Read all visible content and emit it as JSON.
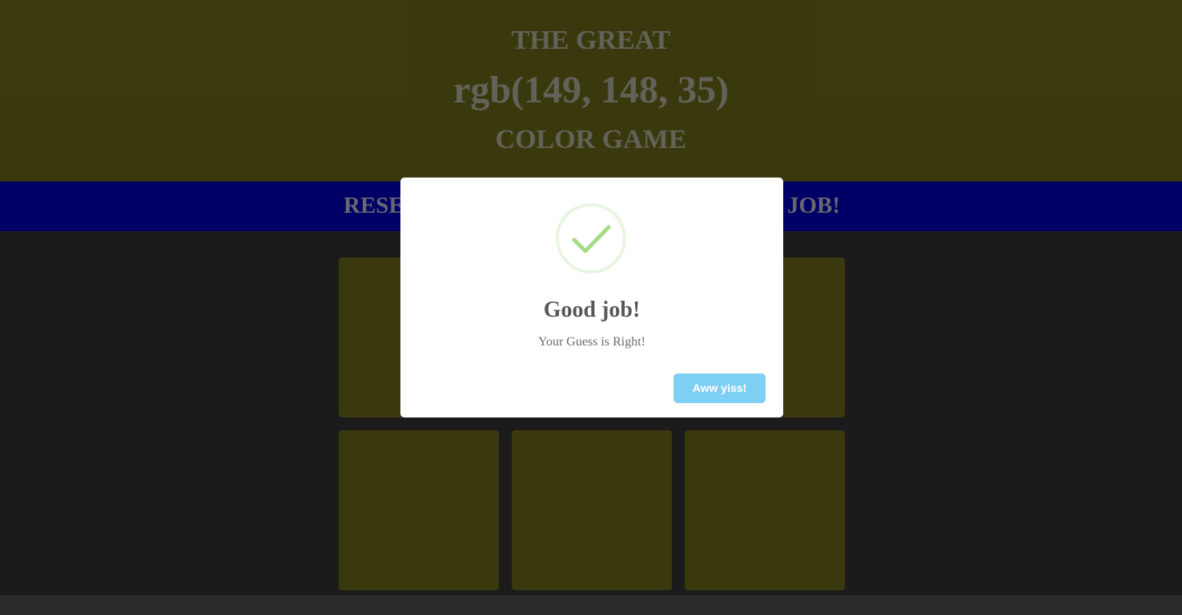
{
  "header": {
    "line1": "THE GREAT",
    "rgb_display": "rgb(149, 148, 35)",
    "line3": "COLOR GAME"
  },
  "stripe": {
    "left_text": "RESE",
    "right_text": "JOB!"
  },
  "modal": {
    "icon": "success-check-icon",
    "title": "Good job!",
    "text": "Your Guess is Right!",
    "confirm_label": "Aww yiss!"
  },
  "colors": {
    "target": "rgb(149, 148, 35)",
    "square_dimmed": "#5c5916",
    "header_dimmed": "#5c5916",
    "stripe": "#0000a0",
    "background": "#2b2b2b",
    "confirm_button": "#7ecff4",
    "success_green": "#a5dc86",
    "success_ring": "#e8f5e0"
  },
  "squares": [
    {
      "color": "rgb(149, 148, 35)"
    },
    {
      "color": "rgb(149, 148, 35)"
    },
    {
      "color": "rgb(149, 148, 35)"
    },
    {
      "color": "rgb(149, 148, 35)"
    },
    {
      "color": "rgb(149, 148, 35)"
    },
    {
      "color": "rgb(149, 148, 35)"
    }
  ]
}
